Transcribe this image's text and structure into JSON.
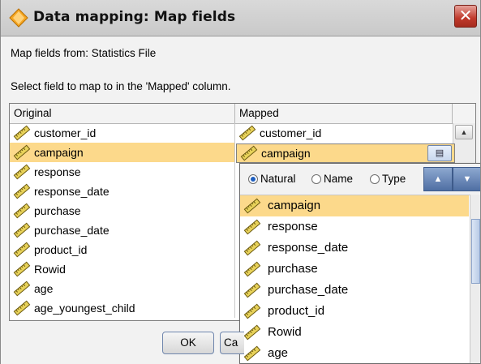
{
  "window": {
    "title": "Data mapping: Map fields",
    "close_symbol": "✕"
  },
  "labels": {
    "map_from": "Map fields from: Statistics File",
    "instruction": "Select field to map to in the 'Mapped' column."
  },
  "table": {
    "columns": [
      "Original",
      "Mapped"
    ],
    "rows": [
      {
        "original": "customer_id",
        "mapped": "customer_id"
      },
      {
        "original": "campaign",
        "mapped": "campaign"
      },
      {
        "original": "response",
        "mapped": ""
      },
      {
        "original": "response_date",
        "mapped": ""
      },
      {
        "original": "purchase",
        "mapped": ""
      },
      {
        "original": "purchase_date",
        "mapped": ""
      },
      {
        "original": "product_id",
        "mapped": ""
      },
      {
        "original": "Rowid",
        "mapped": ""
      },
      {
        "original": "age",
        "mapped": ""
      },
      {
        "original": "age_youngest_child",
        "mapped": ""
      }
    ],
    "selected_row": 1
  },
  "combo": {
    "value": "campaign"
  },
  "popup": {
    "sort_options": [
      "Natural",
      "Name",
      "Type"
    ],
    "selected_sort": "Natural",
    "items": [
      "campaign",
      "response",
      "response_date",
      "purchase",
      "purchase_date",
      "product_id",
      "Rowid",
      "age"
    ],
    "selected_item": "campaign"
  },
  "buttons": {
    "ok": "OK",
    "cancel_partial": "Ca"
  },
  "icons": {
    "title": "diamond-node-icon",
    "field": "ruler-field-icon",
    "sort_asc": "sort-ascending-icon",
    "sort_desc": "sort-descending-icon"
  },
  "colors": {
    "selection": "#fcd98b",
    "title_icon": "#f5a623",
    "close_button": "#c0392b"
  }
}
